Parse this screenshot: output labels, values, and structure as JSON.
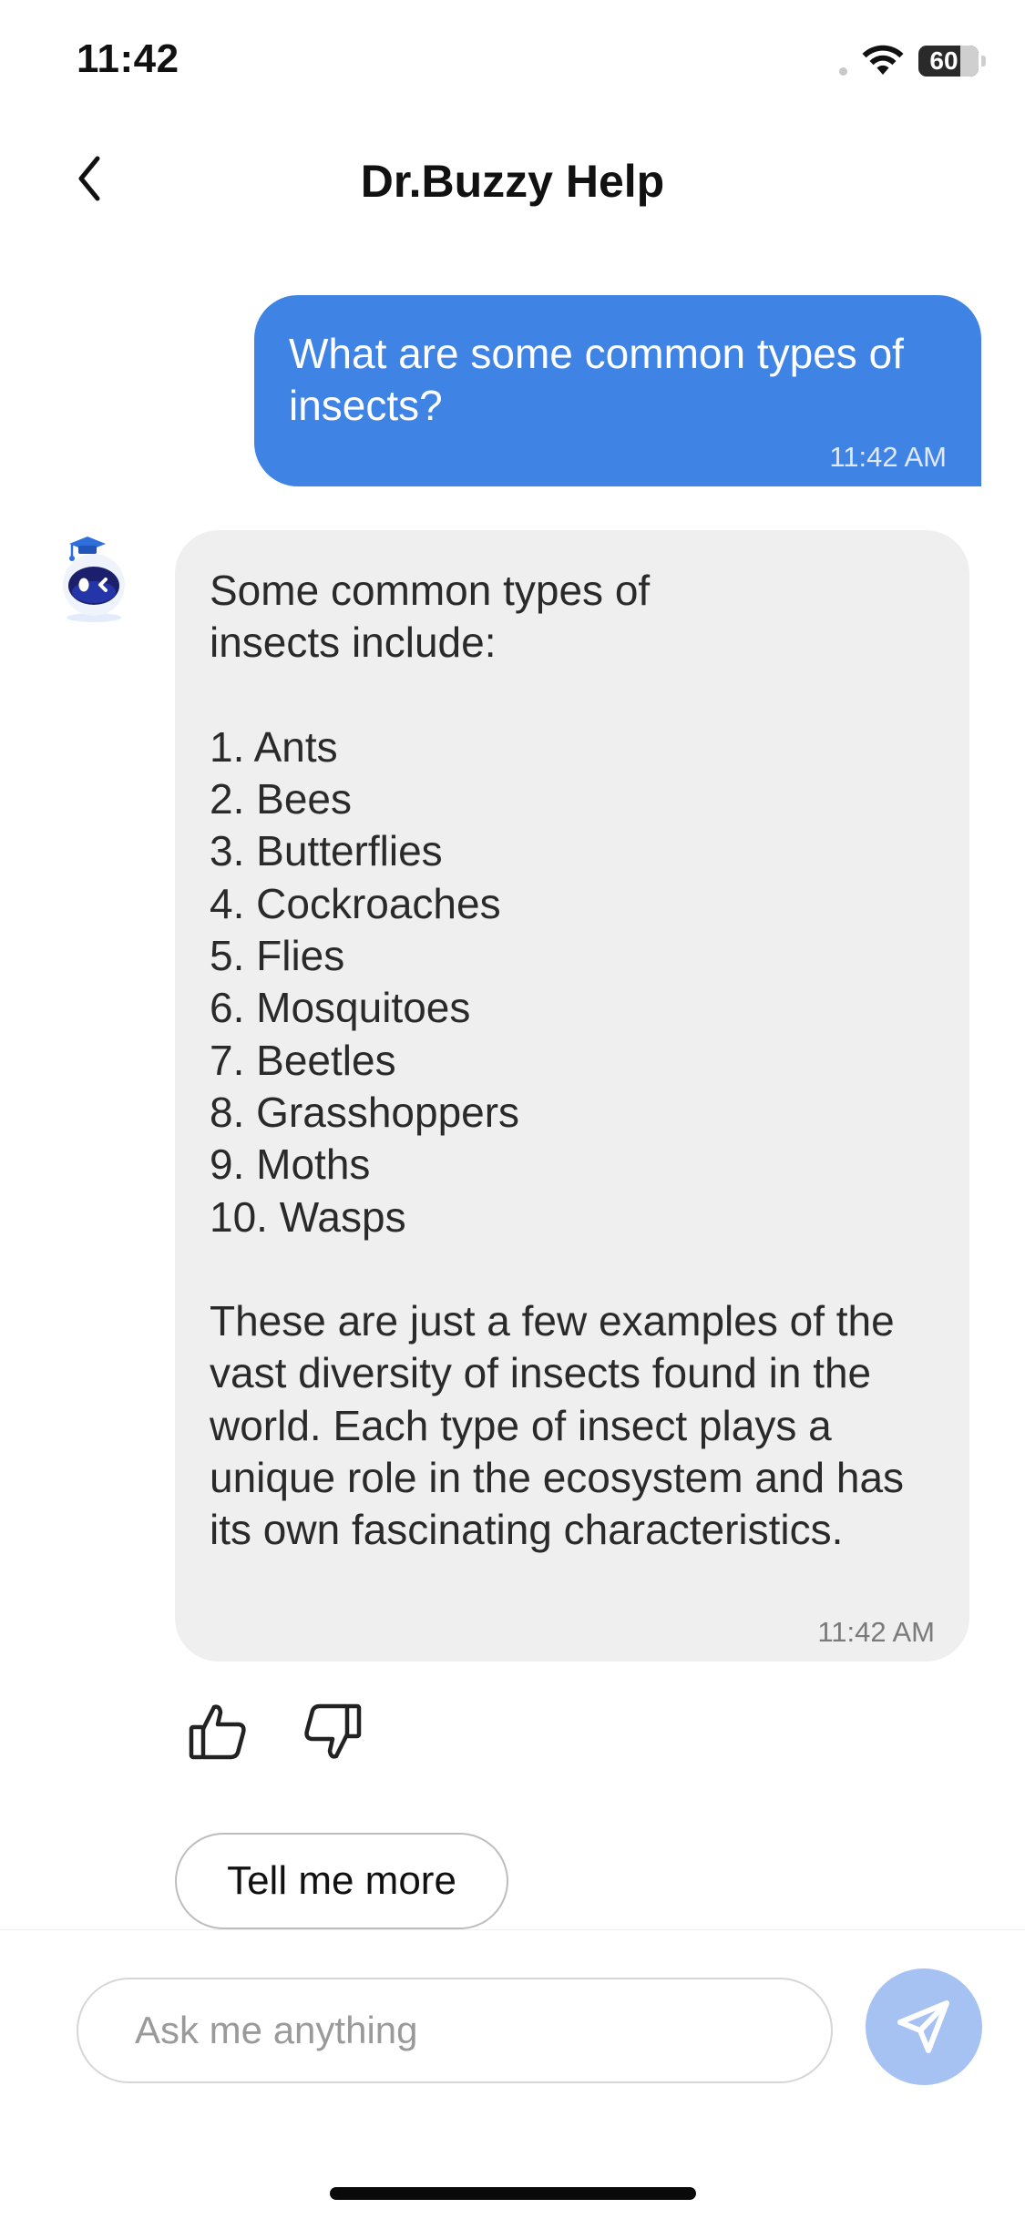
{
  "status_bar": {
    "time": "11:42",
    "battery": "60",
    "icons": [
      "cellular-dot",
      "wifi-icon",
      "battery-icon"
    ]
  },
  "header": {
    "title": "Dr.Buzzy Help",
    "back_icon": "chevron-left-icon"
  },
  "messages": [
    {
      "sender": "user",
      "text": "What are some common types of insects?",
      "time": "11:42 AM"
    },
    {
      "sender": "bot",
      "avatar_icon": "robot-graduate-icon",
      "text": "Some common types of\ninsects include:\n\n1. Ants\n2. Bees\n3. Butterflies\n4. Cockroaches\n5. Flies\n6. Mosquitoes\n7. Beetles\n8. Grasshoppers\n9. Moths\n10. Wasps\n\nThese are just a few examples of the vast diversity of insects found in the world. Each type of insect plays a unique role in the ecosystem and has its own fascinating characteristics.",
      "time": "11:42 AM"
    }
  ],
  "feedback": {
    "like_icon": "thumbs-up-icon",
    "dislike_icon": "thumbs-down-icon"
  },
  "suggestions": [
    "Tell me more"
  ],
  "composer": {
    "placeholder": "Ask me anything",
    "value": "",
    "send_icon": "paper-plane-icon"
  },
  "colors": {
    "user_bubble": "#3f84e5",
    "bot_bubble": "#efefef",
    "send_button": "#a6c2f3"
  }
}
